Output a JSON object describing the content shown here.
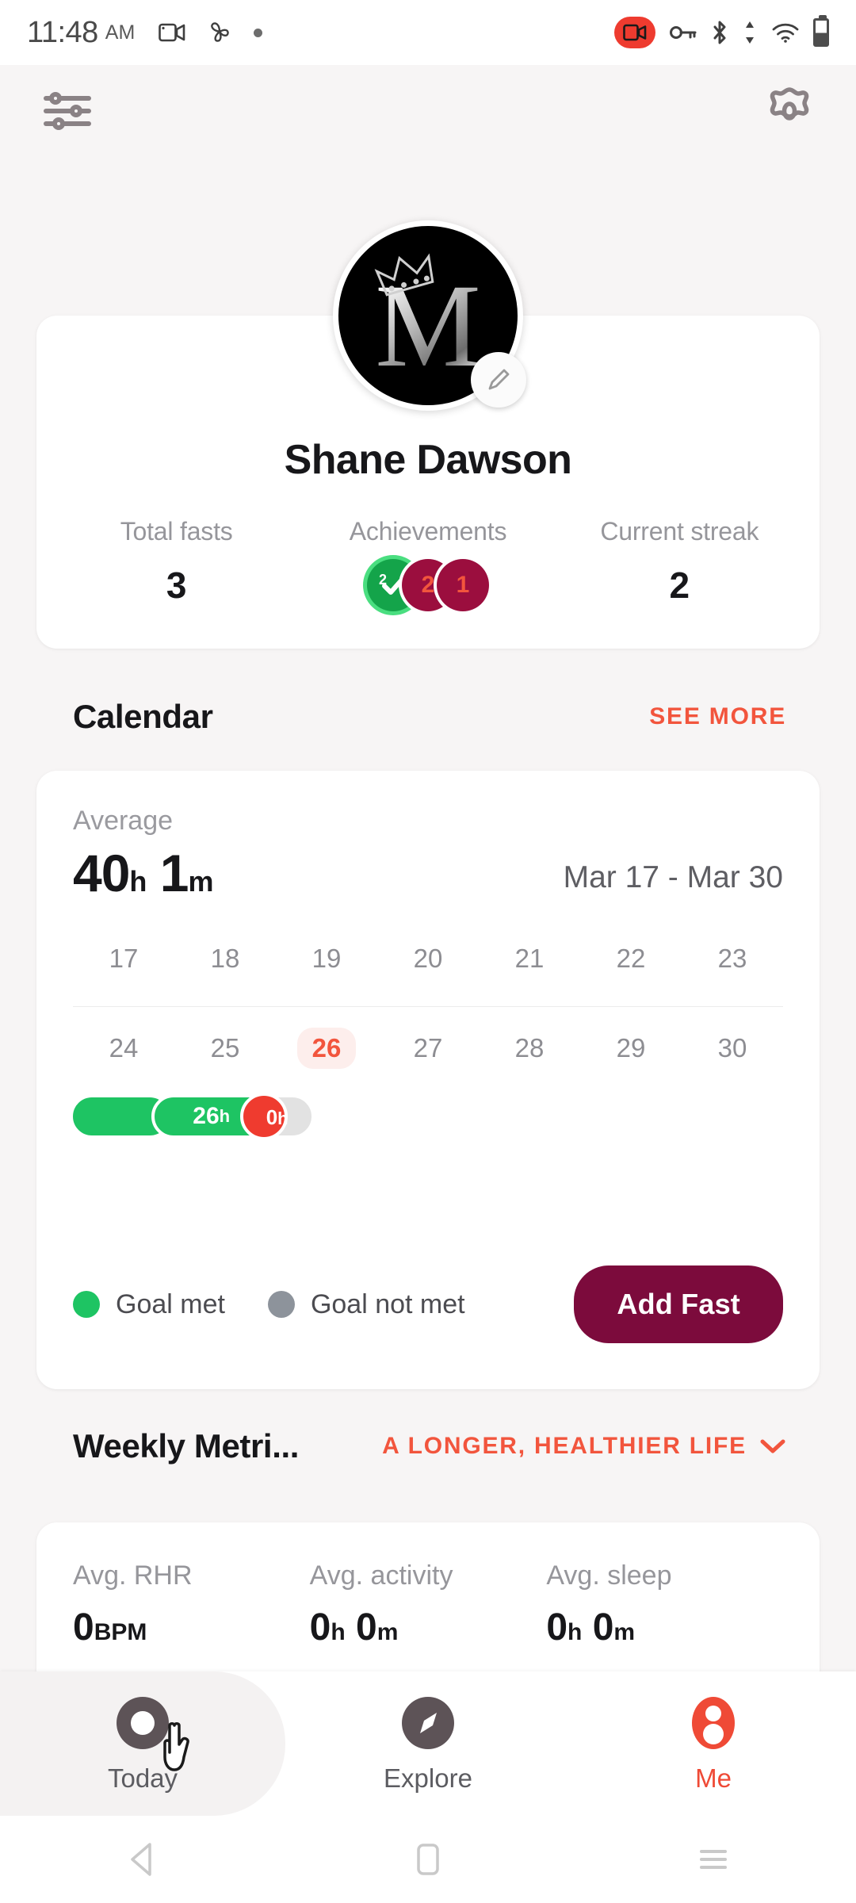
{
  "status_bar": {
    "time": "11:48",
    "ampm": "AM",
    "icons_left": [
      "screen-record-icon",
      "fan-icon",
      "dot-icon"
    ],
    "icons_right": [
      "recording-badge-icon",
      "vpn-key-icon",
      "bluetooth-icon",
      "data-transfer-icon",
      "wifi-icon",
      "battery-icon"
    ]
  },
  "header": {
    "filters_icon": "sliders-icon",
    "settings_icon": "gear-icon"
  },
  "profile": {
    "avatar_letter": "M",
    "avatar_edit_icon": "pencil-icon",
    "name": "Shane Dawson",
    "stats": [
      {
        "label": "Total fasts",
        "value": "3"
      },
      {
        "label": "Achievements",
        "value": ""
      },
      {
        "label": "Current streak",
        "value": "2"
      }
    ],
    "badges": [
      {
        "count": "2",
        "color": "#14a44a",
        "ring": "#4ade80",
        "type": "check"
      },
      {
        "count": "2",
        "color": "#9b0e3e",
        "accent": "#f2553d",
        "type": "number"
      },
      {
        "count": "1",
        "color": "#9b0e3e",
        "accent": "#f2553d",
        "type": "number"
      }
    ]
  },
  "calendar": {
    "title": "Calendar",
    "see_more": "SEE MORE",
    "average_label": "Average",
    "average_hours": "40",
    "average_hours_unit": "h",
    "average_minutes": "1",
    "average_minutes_unit": "m",
    "date_range": "Mar 17 - Mar 30",
    "week1": [
      "17",
      "18",
      "19",
      "20",
      "21",
      "22",
      "23"
    ],
    "week2": [
      "24",
      "25",
      "26",
      "27",
      "28",
      "29",
      "30"
    ],
    "today": "26",
    "legend": [
      {
        "label": "Goal met",
        "color": "#1ec463"
      },
      {
        "label": "Goal not met",
        "color": "#8d939b"
      }
    ],
    "add_fast_label": "Add Fast",
    "bars": [
      {
        "label": "",
        "unit": "",
        "duration_hours": 24,
        "color": "#1ec463",
        "start_pct": 0,
        "width_pct": 32
      },
      {
        "label": "26",
        "unit": "h",
        "duration_hours": 26,
        "color": "#1ec463",
        "start_pct": 33,
        "width_pct": 45
      },
      {
        "label": "0",
        "unit": "h",
        "duration_hours": 0,
        "color": "#e2e2e2",
        "start_pct": 75,
        "width_pct": 28
      }
    ]
  },
  "weekly_metrics": {
    "title": "Weekly Metri...",
    "banner": "A LONGER, HEALTHIER LIFE",
    "chevron_icon": "chevron-down-icon",
    "metrics": [
      {
        "label": "Avg. RHR",
        "value": "0",
        "unit": "BPM"
      },
      {
        "label": "Avg. activity",
        "value_h": "0",
        "unit_h": "h",
        "value_m": "0",
        "unit_m": "m"
      },
      {
        "label": "Avg. sleep",
        "value_h": "0",
        "unit_h": "h",
        "value_m": "0",
        "unit_m": "m"
      }
    ]
  },
  "bottom_nav": {
    "items": [
      {
        "label": "Today",
        "icon": "ring-icon",
        "active": false
      },
      {
        "label": "Explore",
        "icon": "compass-icon",
        "active": false
      },
      {
        "label": "Me",
        "icon": "person-icon",
        "active": true
      }
    ]
  },
  "android_nav": {
    "back_icon": "back-triangle-icon",
    "home_icon": "home-square-icon",
    "recents_icon": "recents-lines-icon"
  },
  "colors": {
    "accent_red": "#f2553d",
    "green": "#1ec463",
    "maroon": "#7c0b3c",
    "bg": "#f7f5f5"
  }
}
